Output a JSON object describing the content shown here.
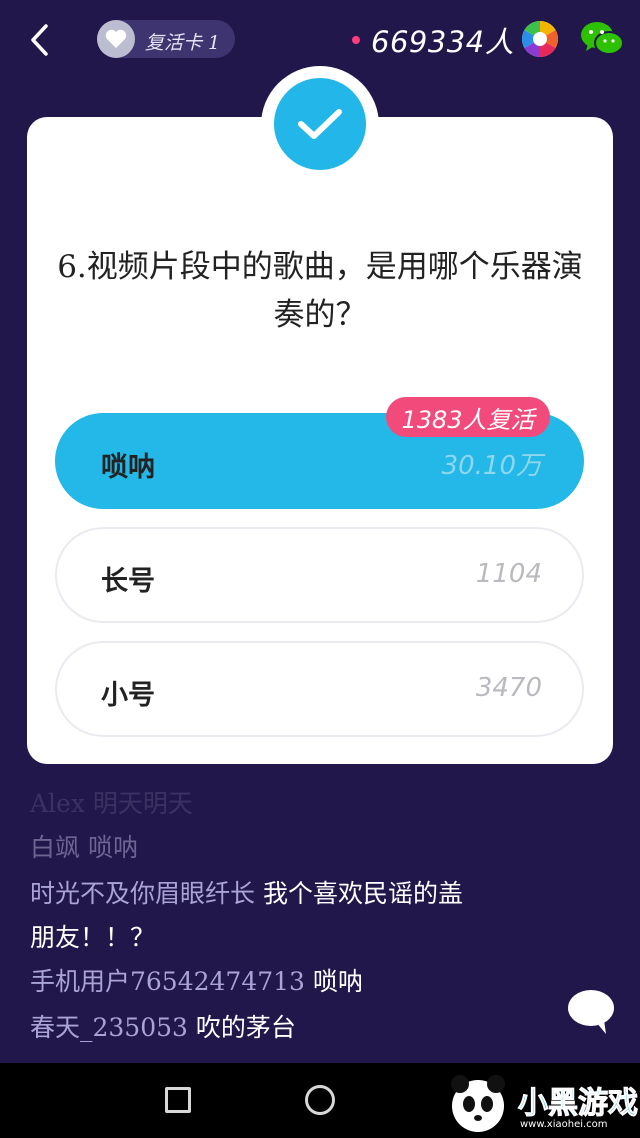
{
  "header": {
    "revive_card_label": "复活卡 1",
    "viewer_count": "669334人"
  },
  "question": {
    "text": "6.视频片段中的歌曲，是用哪个乐器演奏的？"
  },
  "options": [
    {
      "label": "唢呐",
      "count": "30.10万",
      "correct": true
    },
    {
      "label": "长号",
      "count": "1104",
      "correct": false
    },
    {
      "label": "小号",
      "count": "3470",
      "correct": false
    }
  ],
  "revive_badge": "1383人复活",
  "comments": [
    {
      "user": "Alex 明天明天",
      "text": ""
    },
    {
      "user": "白飒 唢呐",
      "text": ""
    },
    {
      "user": "时光不及你眉眼纤长",
      "text": " 我个喜欢民谣的盖"
    },
    {
      "user": "",
      "text": "朋友！！？"
    },
    {
      "user": "手机用户76542474713",
      "text": " 唢呐"
    },
    {
      "user": "春天_235053",
      "text": " 吹的茅台"
    }
  ],
  "watermark": {
    "text": "小黑游戏",
    "url": "www.xiaohei.com"
  },
  "colors": {
    "background": "#22174a",
    "accent": "#23b8e7",
    "badge": "#f24a7a"
  }
}
